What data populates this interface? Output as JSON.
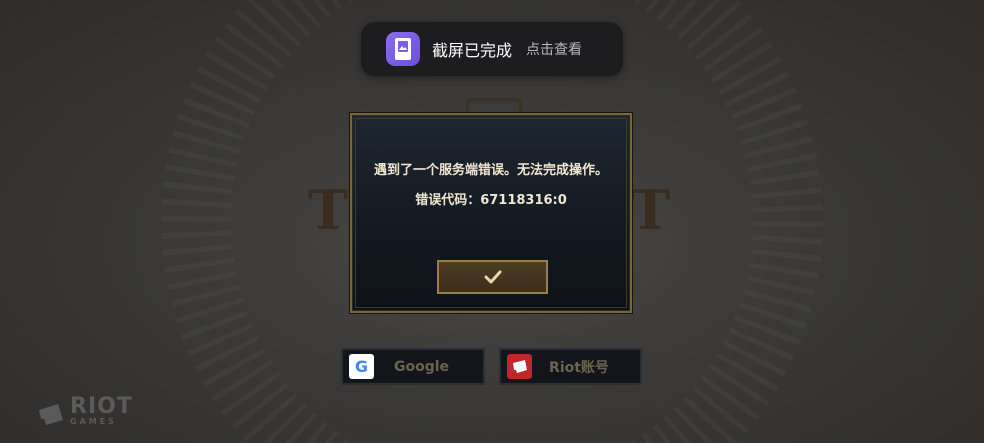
{
  "toast": {
    "title": "截屏已完成",
    "action": "点击查看",
    "icon": "screenshot-icon"
  },
  "dialog": {
    "message": "遇到了一个服务端错误。无法完成操作。",
    "error_code": "错误代码：67118316:0",
    "confirm_icon": "checkmark-icon"
  },
  "login": {
    "google_label": "Google",
    "riot_label": "Riot账号"
  },
  "brand": {
    "riot_word": "RIOT",
    "riot_sub": "GAMES"
  },
  "colors": {
    "gold_border": "#7a6538",
    "dialog_text": "#f0e6d2",
    "toast_bg": "#1d1d1f",
    "toast_icon": "#7c5ee6"
  }
}
